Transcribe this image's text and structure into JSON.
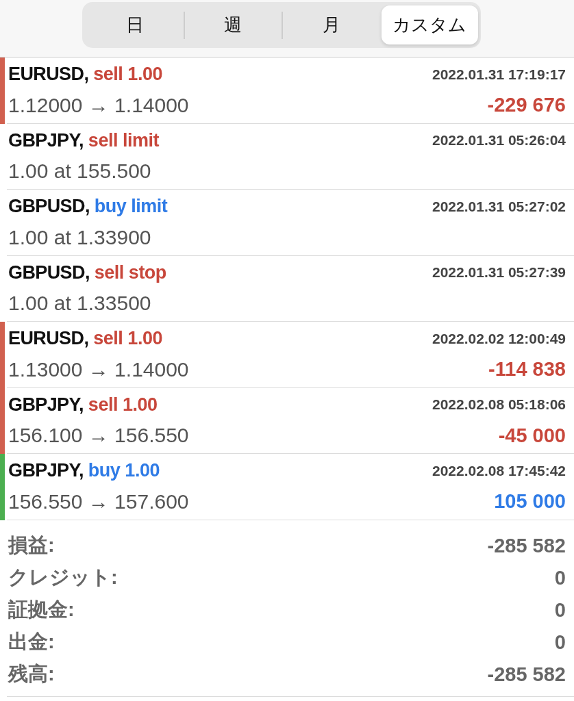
{
  "period_tabs": [
    {
      "label": "日",
      "selected": false
    },
    {
      "label": "週",
      "selected": false
    },
    {
      "label": "月",
      "selected": false
    },
    {
      "label": "カスタム",
      "selected": true
    }
  ],
  "orders": [
    {
      "kind": "sell",
      "symbol": "EURUSD,",
      "order": "sell 1.00",
      "time": "2022.01.31 17:19:17",
      "prices": "1.12000 → 1.14000",
      "profit": "-229 676",
      "color": "#d1604f"
    },
    {
      "kind": "sell",
      "symbol": "GBPJPY,",
      "order": "sell limit",
      "time": "2022.01.31 05:26:04",
      "prices": "1.00 at 155.500"
    },
    {
      "kind": "buy",
      "symbol": "GBPUSD,",
      "order": "buy limit",
      "time": "2022.01.31 05:27:02",
      "prices": "1.00 at 1.33900"
    },
    {
      "kind": "sell",
      "symbol": "GBPUSD,",
      "order": "sell stop",
      "time": "2022.01.31 05:27:39",
      "prices": "1.00 at 1.33500"
    },
    {
      "kind": "sell",
      "symbol": "EURUSD,",
      "order": "sell 1.00",
      "time": "2022.02.02 12:00:49",
      "prices": "1.13000 → 1.14000",
      "profit": "-114 838",
      "color": "#d1604f"
    },
    {
      "kind": "sell",
      "symbol": "GBPJPY,",
      "order": "sell 1.00",
      "time": "2022.02.08 05:18:06",
      "prices": "156.100 → 156.550",
      "profit": "-45 000",
      "color": "#d1604f"
    },
    {
      "kind": "buy",
      "symbol": "GBPJPY,",
      "order": "buy 1.00",
      "time": "2022.02.08 17:45:42",
      "prices": "156.550 → 157.600",
      "profit": "105 000",
      "color": "#4caf50"
    }
  ],
  "summary": [
    {
      "label": "損益:",
      "value": "-285 582"
    },
    {
      "label": "クレジット:",
      "value": "0"
    },
    {
      "label": "証拠金:",
      "value": "0"
    },
    {
      "label": "出金:",
      "value": "0"
    },
    {
      "label": "残高:",
      "value": "-285 582"
    }
  ]
}
